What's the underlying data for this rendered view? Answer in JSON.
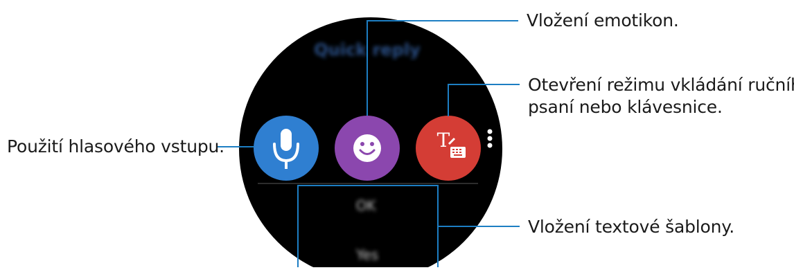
{
  "callouts": {
    "voice_input": "Použití hlasového vstupu.",
    "emoji_insert": "Vložení emotikon.",
    "handwriting_line1": "Otevření režimu vkládání ručního",
    "handwriting_line2": "psaní nebo klávesnice.",
    "text_template": "Vložení textové šablony."
  },
  "watch_screen": {
    "blurred_title": "Quick reply",
    "blurred_item_1": "OK",
    "blurred_item_2": "Yes"
  },
  "buttons": [
    {
      "name": "voice-input-button",
      "icon": "microphone-icon",
      "color": "#2f7fd1"
    },
    {
      "name": "emoji-button",
      "icon": "smiley-icon",
      "color": "#8b47ae"
    },
    {
      "name": "handwriting-keyboard-button",
      "icon": "handwriting-keyboard-icon",
      "color": "#d43d35"
    }
  ],
  "colors": {
    "leader_line": "#1d7ec3",
    "watch_bg": "#000000"
  }
}
